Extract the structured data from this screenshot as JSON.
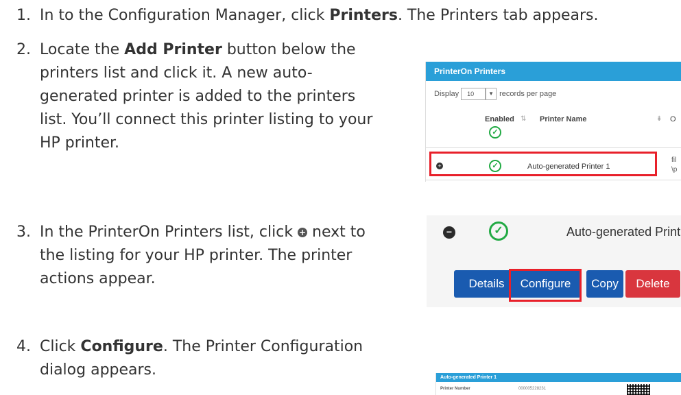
{
  "steps": [
    {
      "num": "1.",
      "pre": "In to the Configuration Manager, click ",
      "bold": "Printers",
      "post": ". The Printers tab appears."
    },
    {
      "num": "2.",
      "line1_pre": "Locate the ",
      "line1_bold": "Add Printer",
      "line1_post": " button below the",
      "line2": "printers list and click it. A new auto-",
      "line3": "generated printer is added to the printers",
      "line4": "list. You’ll connect this printer listing to your",
      "line5": "HP printer."
    },
    {
      "num": "3.",
      "line1_pre": "In the PrinterOn Printers list, click ",
      "line1_post": " next to",
      "line2": "the listing for your HP printer. The printer",
      "line3": "actions appear."
    },
    {
      "num": "4.",
      "line1_pre": "Click ",
      "line1_bold": "Configure",
      "line1_post": ". The Printer Configuration",
      "line2": "dialog appears."
    }
  ],
  "shot1": {
    "header": "PrinterOn Printers",
    "display_label": "Display",
    "display_value": "10",
    "records_label": "records per page",
    "col_enabled": "Enabled",
    "col_name": "Printer Name",
    "col_trunc": "O",
    "row_name": "Auto-generated Printer 1",
    "row_trunc1": "fil",
    "row_trunc2": "\\p"
  },
  "shot2": {
    "printer_name": "Auto-generated Print",
    "buttons": {
      "details": "Details",
      "configure": "Configure",
      "copy": "Copy",
      "delete": "Delete"
    }
  },
  "shot3": {
    "header": "Auto-generated Printer 1",
    "field_label": "Printer Number",
    "field_value": "000005228231"
  },
  "colors": {
    "header_blue": "#2a9fd8",
    "button_blue": "#1a5bb0",
    "delete_red": "#d9363e",
    "highlight_red": "#e8202a",
    "check_green": "#22aa44"
  },
  "icons": [
    "check-circle-icon",
    "plus-circle-icon",
    "minus-circle-icon",
    "sort-icon",
    "dropdown-arrow-icon",
    "qr-code-icon"
  ]
}
